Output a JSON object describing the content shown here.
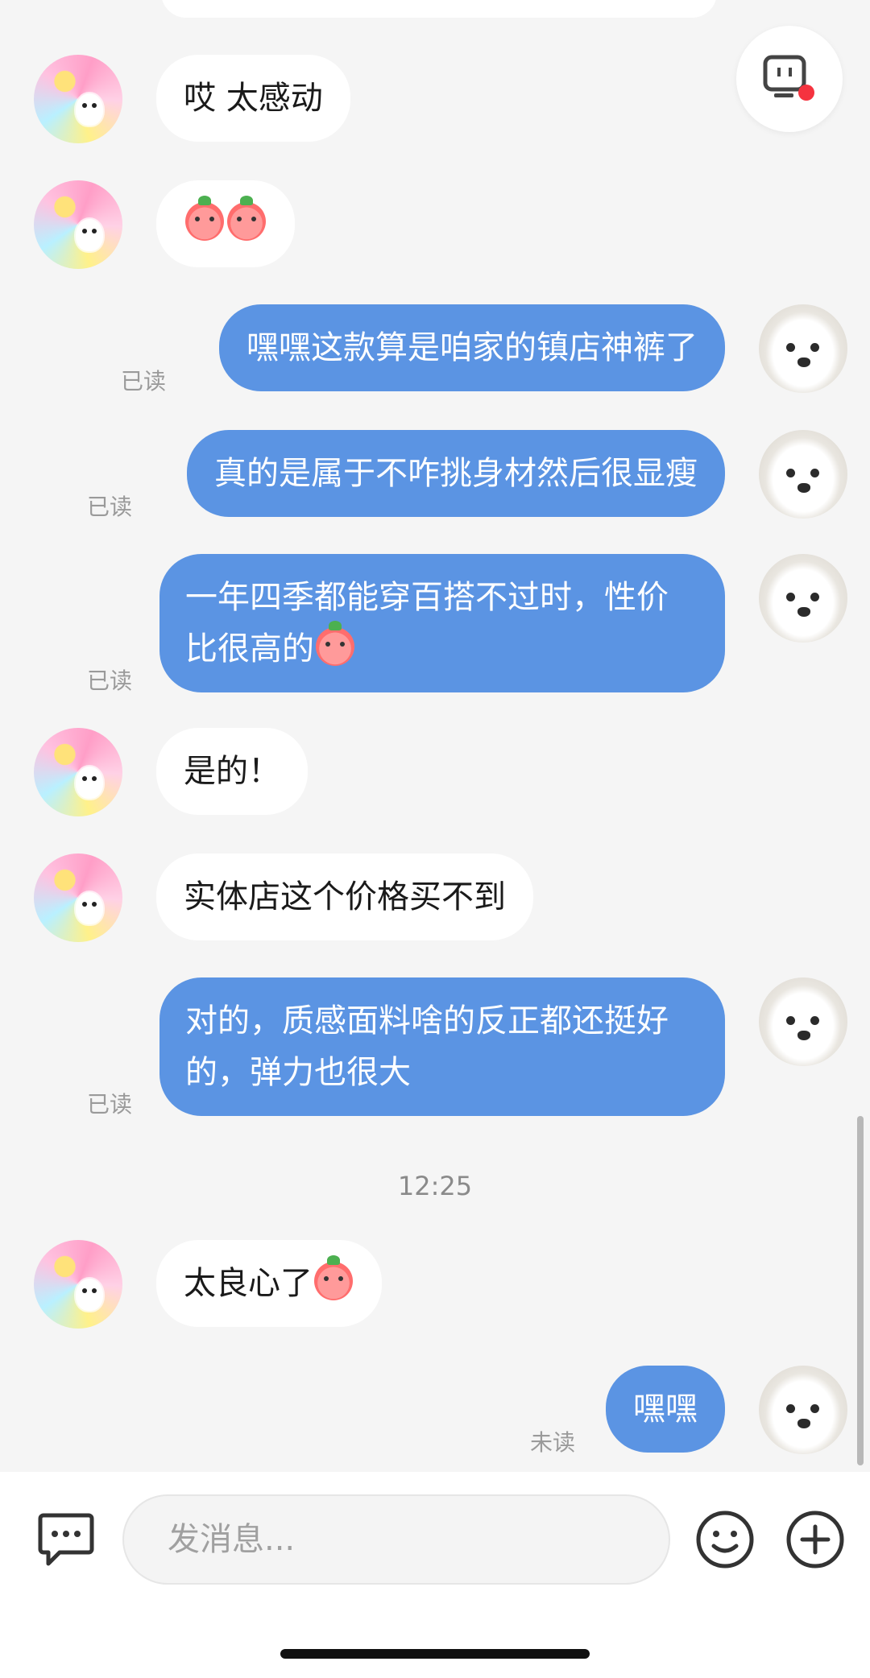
{
  "messages": [
    {
      "text": "哎 太感动"
    },
    {
      "text": ""
    },
    {
      "text": "嘿嘿这款算是咱家的镇店神裤了",
      "status": "已读"
    },
    {
      "text": "真的是属于不咋挑身材然后很显瘦",
      "status": "已读"
    },
    {
      "text": "一年四季都能穿百搭不过时，性价比很高的",
      "status": "已读"
    },
    {
      "text": "是的！"
    },
    {
      "text": "实体店这个价格买不到"
    },
    {
      "text": "对的，质感面料啥的反正都还挺好的，弹力也很大",
      "status": "已读"
    },
    {
      "text": "太良心了"
    },
    {
      "text": "嘿嘿",
      "status": "未读"
    }
  ],
  "timestamp": "12:25",
  "composer": {
    "placeholder": "发消息..."
  },
  "icons": {
    "assistant": "robot-screen-icon",
    "unread_dot_color": "#f5333f",
    "message": "message-bubble-icon",
    "emoji": "smiley-icon",
    "plus": "plus-circle-icon"
  },
  "colors": {
    "outgoing_bubble": "#5b94e3",
    "incoming_bubble": "#ffffff",
    "background": "#f5f5f5"
  }
}
